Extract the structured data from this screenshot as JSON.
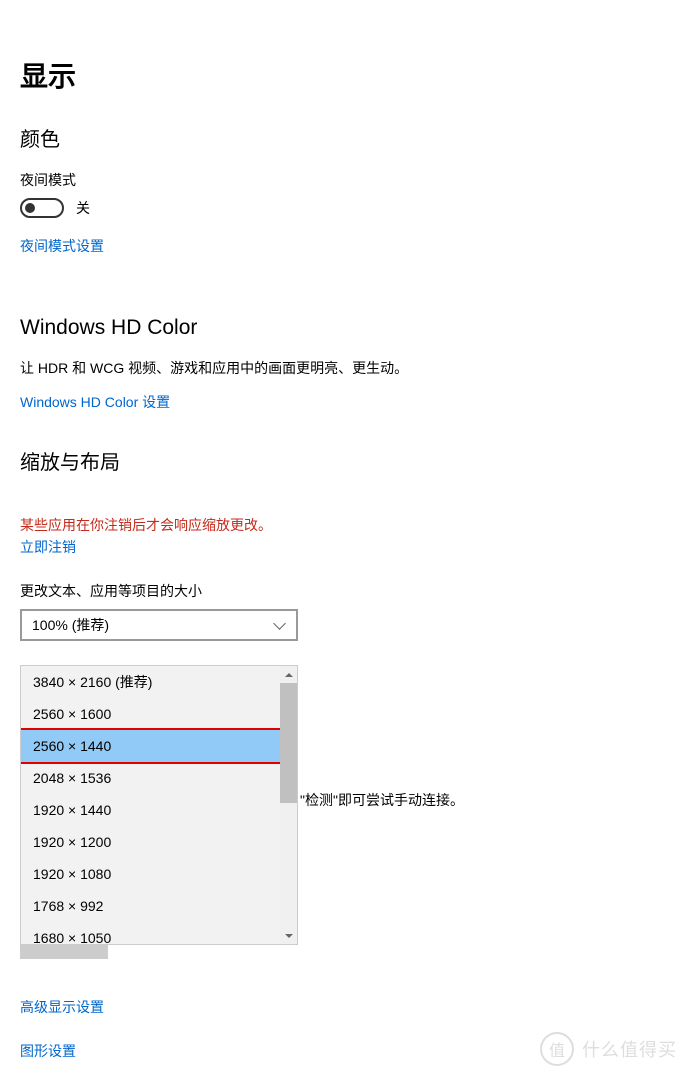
{
  "page": {
    "title": "显示"
  },
  "color": {
    "section_title": "颜色",
    "night_mode_label": "夜间模式",
    "toggle_state": "关",
    "night_mode_settings_link": "夜间模式设置"
  },
  "hdcolor": {
    "section_title": "Windows HD Color",
    "description": "让 HDR 和 WCG 视频、游戏和应用中的画面更明亮、更生动。",
    "settings_link": "Windows HD Color 设置"
  },
  "scale": {
    "section_title": "缩放与布局",
    "warning_text": "某些应用在你注销后才会响应缩放更改。",
    "signout_link": "立即注销",
    "scale_label": "更改文本、应用等项目的大小",
    "scale_value": "100% (推荐)"
  },
  "resolution": {
    "options": [
      {
        "label": "3840 × 2160 (推荐)",
        "selected": false,
        "highlighted": false
      },
      {
        "label": "2560 × 1600",
        "selected": false,
        "highlighted": false
      },
      {
        "label": "2560 × 1440",
        "selected": true,
        "highlighted": true
      },
      {
        "label": "2048 × 1536",
        "selected": false,
        "highlighted": false
      },
      {
        "label": "1920 × 1440",
        "selected": false,
        "highlighted": false
      },
      {
        "label": "1920 × 1200",
        "selected": false,
        "highlighted": false
      },
      {
        "label": "1920 × 1080",
        "selected": false,
        "highlighted": false
      },
      {
        "label": "1768 × 992",
        "selected": false,
        "highlighted": false
      },
      {
        "label": "1680 × 1050",
        "selected": false,
        "highlighted": false
      }
    ]
  },
  "detect_text": "\"检测\"即可尝试手动连接。",
  "links": {
    "advanced_display": "高级显示设置",
    "graphics": "图形设置"
  },
  "watermark": {
    "icon": "值",
    "text": "什么值得买"
  }
}
